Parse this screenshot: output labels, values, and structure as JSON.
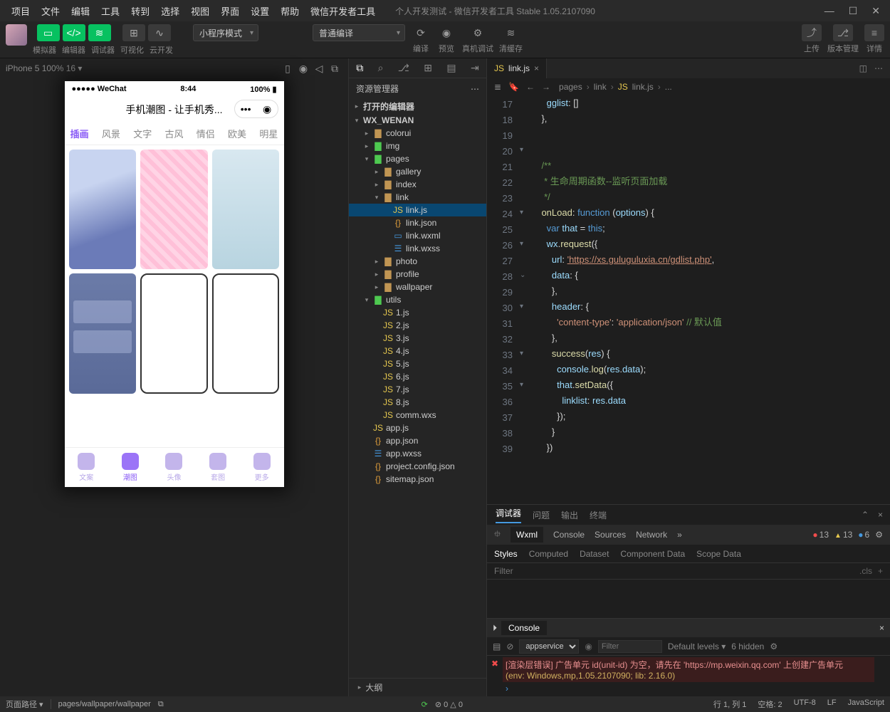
{
  "menu": [
    "项目",
    "文件",
    "编辑",
    "工具",
    "转到",
    "选择",
    "视图",
    "界面",
    "设置",
    "帮助",
    "微信开发者工具"
  ],
  "title": "个人开发测试 - 微信开发者工具 Stable 1.05.2107090",
  "toolbar": {
    "group1_labels": [
      "模拟器",
      "编辑器",
      "调试器"
    ],
    "group2_labels": [
      "可视化",
      "云开发"
    ],
    "mode": "小程序模式",
    "compile": "普通编译",
    "actions": [
      "编译",
      "预览",
      "真机调试",
      "清缓存"
    ],
    "right": [
      "上传",
      "版本管理",
      "详情"
    ]
  },
  "sim_header": "iPhone 5 100% 16 ▾",
  "phone": {
    "carrier": "●●●●● WeChat",
    "time": "8:44",
    "battery": "100%",
    "app_title": "手机潮图 - 让手机秀...",
    "tabs": [
      "插画",
      "风景",
      "文字",
      "古风",
      "情侣",
      "欧美",
      "明星"
    ],
    "nav": [
      "文案",
      "潮图",
      "头像",
      "套图",
      "更多"
    ]
  },
  "explorer": {
    "title": "资源管理器",
    "sections": [
      "打开的编辑器",
      "WX_WENAN"
    ],
    "tree": [
      {
        "d": 1,
        "t": "folder",
        "n": "colorui",
        "a": "▸"
      },
      {
        "d": 1,
        "t": "folder-g",
        "n": "img",
        "a": "▸"
      },
      {
        "d": 1,
        "t": "folder-g",
        "n": "pages",
        "a": "▾"
      },
      {
        "d": 2,
        "t": "folder",
        "n": "gallery",
        "a": "▸"
      },
      {
        "d": 2,
        "t": "folder",
        "n": "index",
        "a": "▸"
      },
      {
        "d": 2,
        "t": "folder",
        "n": "link",
        "a": "▾"
      },
      {
        "d": 3,
        "t": "js",
        "n": "link.js",
        "sel": true
      },
      {
        "d": 3,
        "t": "json",
        "n": "link.json"
      },
      {
        "d": 3,
        "t": "wxml",
        "n": "link.wxml"
      },
      {
        "d": 3,
        "t": "wxss",
        "n": "link.wxss"
      },
      {
        "d": 2,
        "t": "folder",
        "n": "photo",
        "a": "▸"
      },
      {
        "d": 2,
        "t": "folder",
        "n": "profile",
        "a": "▸"
      },
      {
        "d": 2,
        "t": "folder",
        "n": "wallpaper",
        "a": "▸"
      },
      {
        "d": 1,
        "t": "folder-g",
        "n": "utils",
        "a": "▾"
      },
      {
        "d": 2,
        "t": "js",
        "n": "1.js"
      },
      {
        "d": 2,
        "t": "js",
        "n": "2.js"
      },
      {
        "d": 2,
        "t": "js",
        "n": "3.js"
      },
      {
        "d": 2,
        "t": "js",
        "n": "4.js"
      },
      {
        "d": 2,
        "t": "js",
        "n": "5.js"
      },
      {
        "d": 2,
        "t": "js",
        "n": "6.js"
      },
      {
        "d": 2,
        "t": "js",
        "n": "7.js"
      },
      {
        "d": 2,
        "t": "js",
        "n": "8.js"
      },
      {
        "d": 2,
        "t": "wxs",
        "n": "comm.wxs"
      },
      {
        "d": 1,
        "t": "js",
        "n": "app.js"
      },
      {
        "d": 1,
        "t": "json",
        "n": "app.json"
      },
      {
        "d": 1,
        "t": "wxss",
        "n": "app.wxss"
      },
      {
        "d": 1,
        "t": "json",
        "n": "project.config.json"
      },
      {
        "d": 1,
        "t": "json",
        "n": "sitemap.json"
      }
    ],
    "outline": "大纲"
  },
  "editor": {
    "tab": "link.js",
    "breadcrumb": [
      "pages",
      "link",
      "link.js",
      "..."
    ],
    "line_start": 17,
    "lines": [
      "      gglist: []",
      "    },",
      "",
      "",
      "    /**",
      "     * 生命周期函数--监听页面加载",
      "     */",
      "    onLoad: function (options) {",
      "      var that = this;",
      "      wx.request({",
      "        url: 'https://xs.guluguluxia.cn/gdlist.php',",
      "        data: {",
      "        },",
      "        header: {",
      "          'content-type': 'application/json' // 默认值",
      "        },",
      "        success(res) {",
      "          console.log(res.data);",
      "          that.setData({",
      "            linklist: res.data",
      "          });",
      "        }",
      "      })"
    ]
  },
  "debugger": {
    "top_tabs": [
      "调试器",
      "问题",
      "输出",
      "终端"
    ],
    "dev_tabs": [
      "Wxml",
      "Console",
      "Sources",
      "Network"
    ],
    "badges": {
      "red": "13",
      "yellow": "13",
      "blue": "6"
    },
    "style_tabs": [
      "Styles",
      "Computed",
      "Dataset",
      "Component Data",
      "Scope Data"
    ],
    "filter_ph": "Filter",
    "cls": ".cls",
    "console_tab": "Console",
    "context": "appservice",
    "levels": "Default levels ▾",
    "hidden": "6 hidden",
    "error": "[渲染层错误] 广告单元 id(unit-id) 为空，请先在 'https://mp.weixin.qq.com' 上创建广告单元",
    "error_env": "(env: Windows,mp,1.05.2107090; lib: 2.16.0)"
  },
  "status": {
    "left_label": "页面路径 ▾",
    "path": "pages/wallpaper/wallpaper",
    "metrics": "⊘ 0 △ 0",
    "right": [
      "行 1, 列 1",
      "空格: 2",
      "UTF-8",
      "LF",
      "JavaScript"
    ]
  }
}
